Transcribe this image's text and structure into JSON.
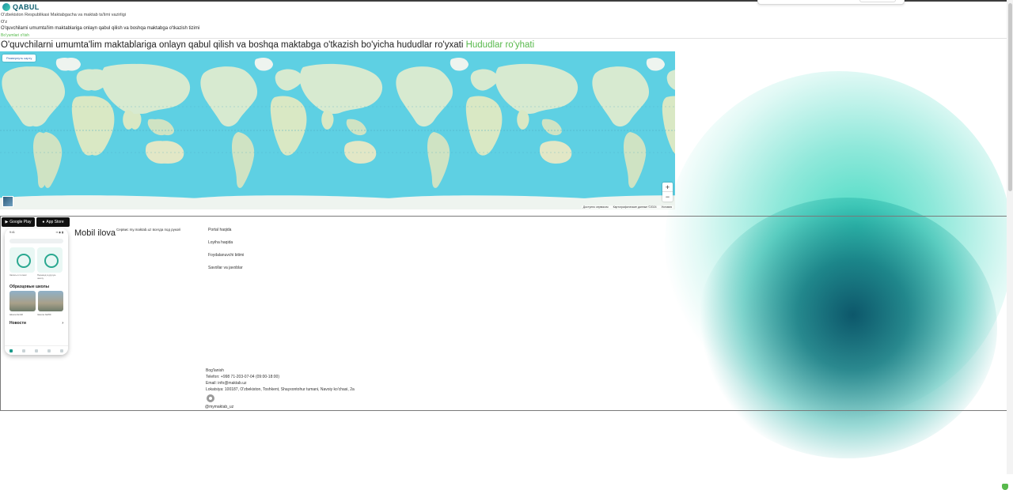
{
  "header": {
    "logo_text": "QABUL",
    "ministry": "O'zbekiston Respublikasi Maktabgacha va maktab ta'limi vazirligi",
    "language": "O'z",
    "system_name": "O'quvchilarni umumta'lim maktablariga onlayn qabul qilish va boshqa maktabga o'tkazish tizimi",
    "back_link": "Bo'yumlari o'tish"
  },
  "main": {
    "heading": "O'quvchilarni umumta'lim maktablariga onlayn qabul qilish va boshqa maktabga o'tkazish bo'yicha hududlar ro'yxati",
    "heading_link": "Hududlar ro'yhati"
  },
  "map": {
    "toggle_label": "Развернуть карту",
    "zoom_in": "+",
    "zoom_out": "−",
    "attribution": [
      "Доступно сервисом",
      "Картографические данные ©2024",
      "Условия"
    ],
    "colors": {
      "water": "#5ed0e3",
      "land": "#d7ead0"
    }
  },
  "footer": {
    "store_badges": [
      "Google Play",
      "App Store"
    ],
    "mobile_title": "Mobil ilova",
    "mobile_subtitle": "Сервис my.maktab.uz всегда под рукой",
    "phone": {
      "time": "9:41",
      "signal": "▪▪ ◉ ▮",
      "card_labels": [
        "Запись в 1 класс",
        "Перевод в другую школу"
      ],
      "section_schools": "Образцовые школы",
      "school_labels": [
        "Школа №102",
        "Школа №250"
      ],
      "section_news": "Новости",
      "news_arrow": "›"
    },
    "links": [
      "Portal haqida",
      "Loyiha haqida",
      "Foydalanuvchi bitimi",
      "Savollar va javoblar"
    ],
    "contacts": {
      "title": "Bog'lanish",
      "phone": "Telefon: +998 71-203-07-04 (09:00-18:00)",
      "email": "Email: info@maktab.uz",
      "location": "Lokatsiya: 100187, O'zbekiston, Toshkent, Shayxontohur tumani, Navoiy ko'chasi, 2a"
    },
    "handle": "@mymaktab_uz"
  }
}
